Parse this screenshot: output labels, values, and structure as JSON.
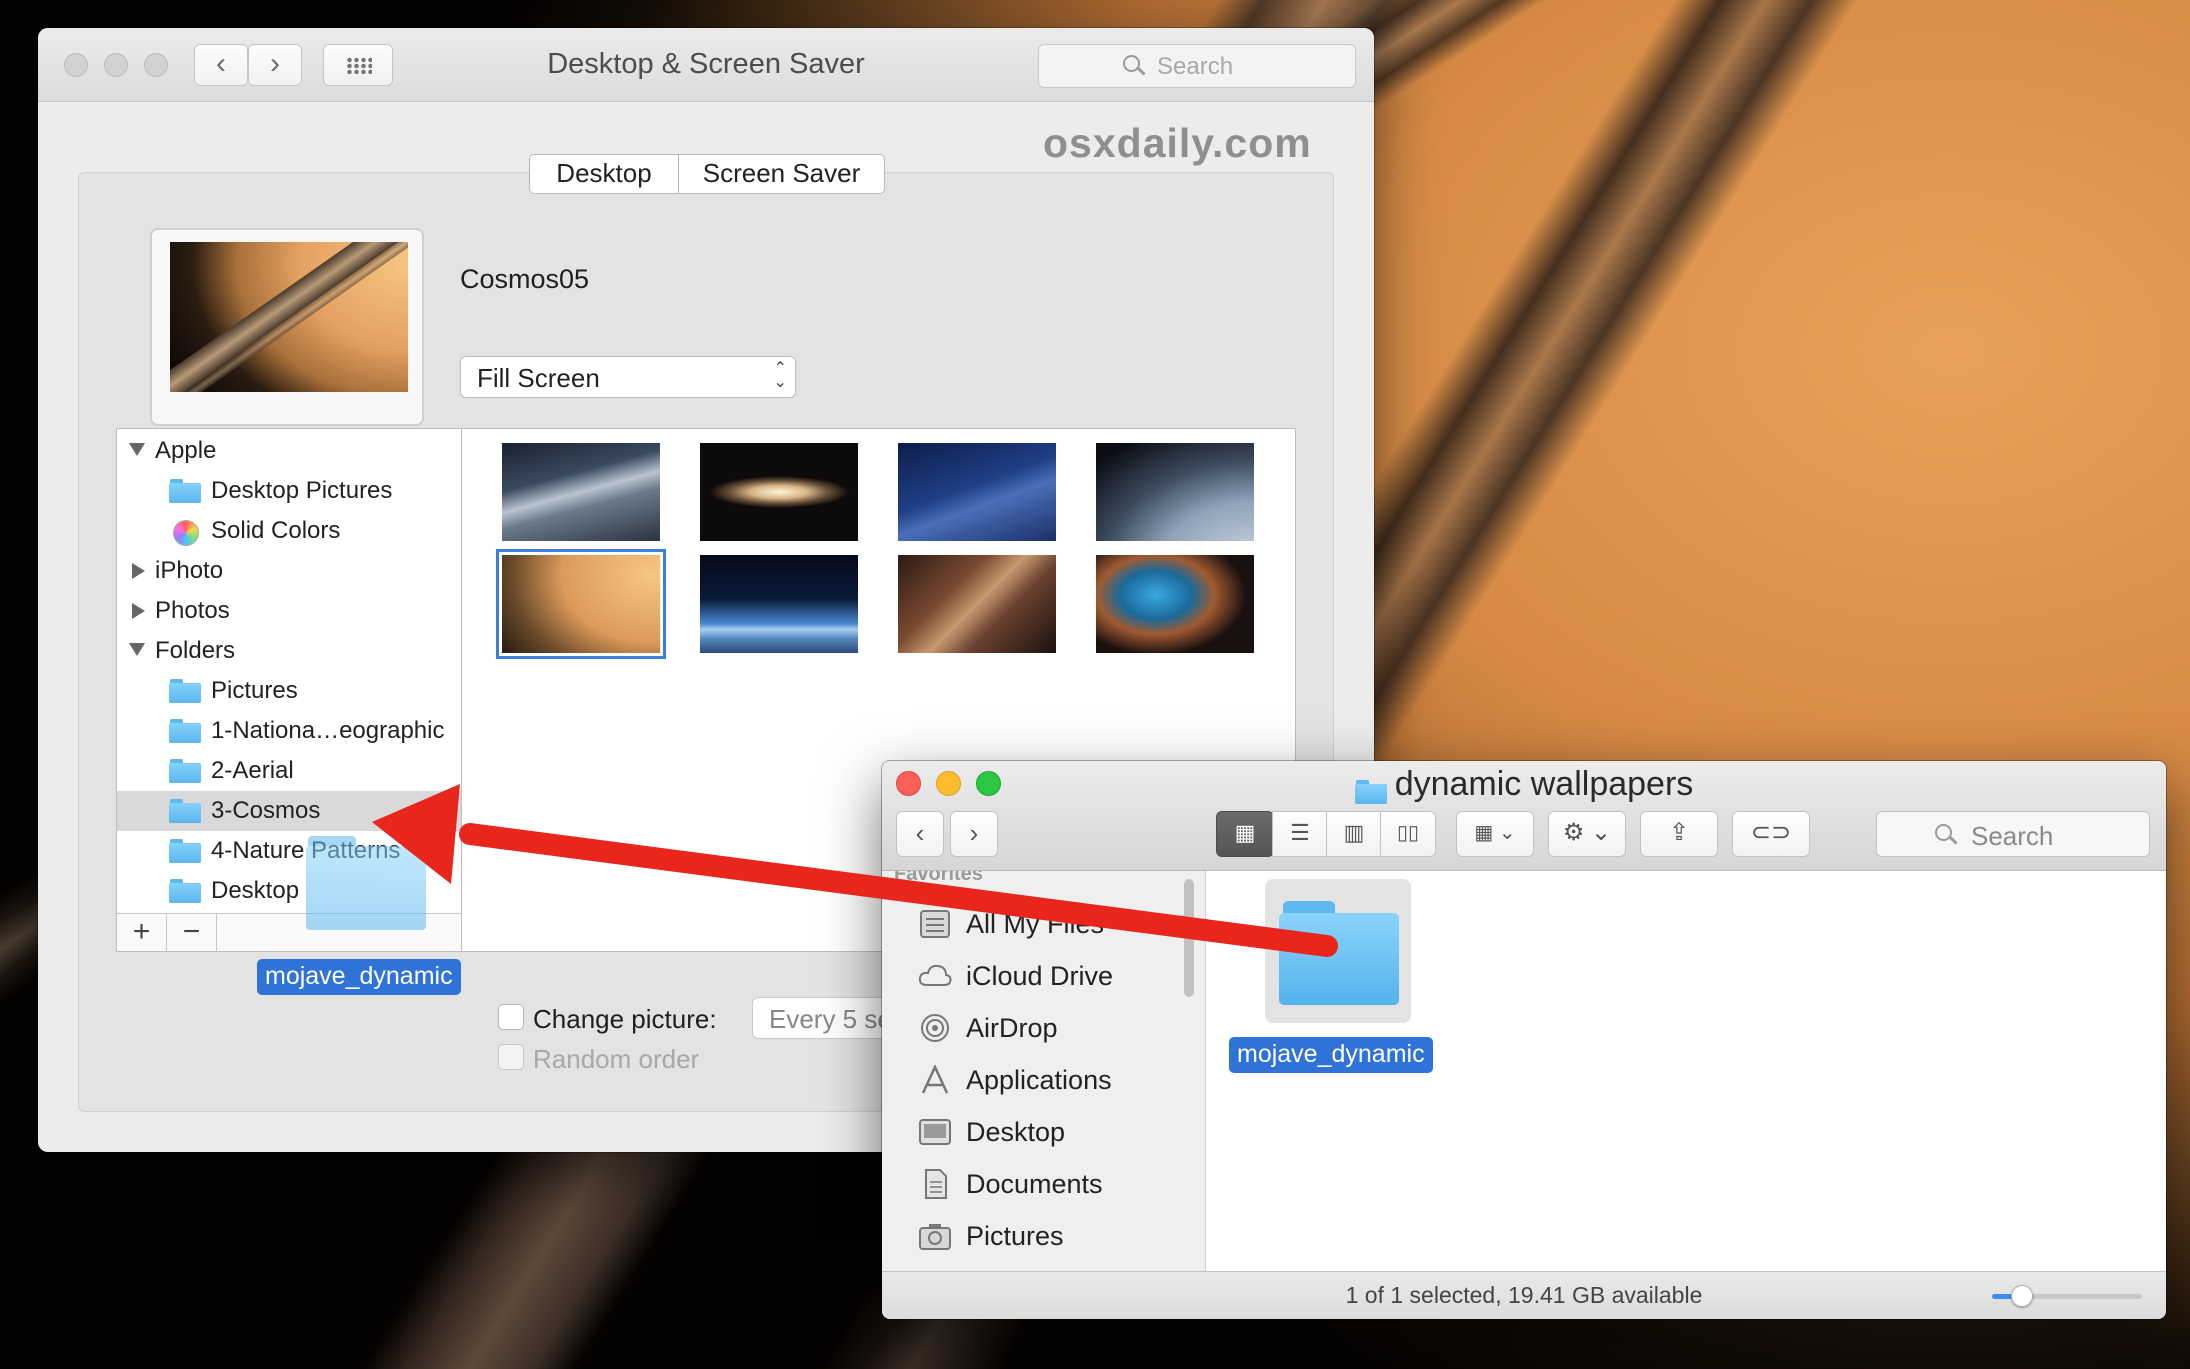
{
  "colors": {
    "accent": "#2f73d8",
    "arrow": "#e8261c",
    "folder": "#6cc4f5"
  },
  "prefs": {
    "title": "Desktop & Screen Saver",
    "search_placeholder": "Search",
    "watermark": "osxdaily.com",
    "tabs": [
      {
        "label": "Desktop",
        "selected": false
      },
      {
        "label": "Screen Saver",
        "selected": true
      }
    ],
    "current_picture": "Cosmos05",
    "fill_mode": "Fill Screen",
    "sources": [
      {
        "label": "Apple",
        "kind": "group",
        "expanded": true
      },
      {
        "label": "Desktop Pictures",
        "kind": "folder"
      },
      {
        "label": "Solid Colors",
        "kind": "colors"
      },
      {
        "label": "iPhoto",
        "kind": "group",
        "expanded": false
      },
      {
        "label": "Photos",
        "kind": "group",
        "expanded": false
      },
      {
        "label": "Folders",
        "kind": "group",
        "expanded": true
      },
      {
        "label": "Pictures",
        "kind": "folder"
      },
      {
        "label": "1-Nationa…eographic",
        "kind": "folder"
      },
      {
        "label": "2-Aerial",
        "kind": "folder"
      },
      {
        "label": "3-Cosmos",
        "kind": "folder",
        "selected": true
      },
      {
        "label": "4-Nature Patterns",
        "kind": "folder"
      },
      {
        "label": "Desktop",
        "kind": "folder"
      }
    ],
    "add_label": "+",
    "remove_label": "−",
    "thumbnails": [
      {
        "name": "earth-horizon",
        "selected": false
      },
      {
        "name": "sombrero-galaxy",
        "selected": false
      },
      {
        "name": "milky-way-sky",
        "selected": false
      },
      {
        "name": "earth-clouds",
        "selected": false
      },
      {
        "name": "saturn",
        "selected": true
      },
      {
        "name": "earth-moon",
        "selected": false
      },
      {
        "name": "milky-way-core",
        "selected": false
      },
      {
        "name": "nebula",
        "selected": false
      }
    ],
    "change_picture_label": "Change picture:",
    "change_interval": "Every 5 seconds",
    "random_order_label": "Random order",
    "drag_label": "mojave_dynamic"
  },
  "finder": {
    "title": "dynamic wallpapers",
    "search_placeholder": "Search",
    "sidebar_heading": "Favorites",
    "sidebar_items": [
      {
        "label": "All My Files",
        "icon": "all-files-icon"
      },
      {
        "label": "iCloud Drive",
        "icon": "cloud-icon"
      },
      {
        "label": "AirDrop",
        "icon": "airdrop-icon"
      },
      {
        "label": "Applications",
        "icon": "applications-icon"
      },
      {
        "label": "Desktop",
        "icon": "desktop-icon"
      },
      {
        "label": "Documents",
        "icon": "documents-icon"
      },
      {
        "label": "Pictures",
        "icon": "camera-icon"
      }
    ],
    "file_name": "mojave_dynamic",
    "status": "1 of 1 selected, 19.41 GB available",
    "icon_size_level": 0.2
  }
}
